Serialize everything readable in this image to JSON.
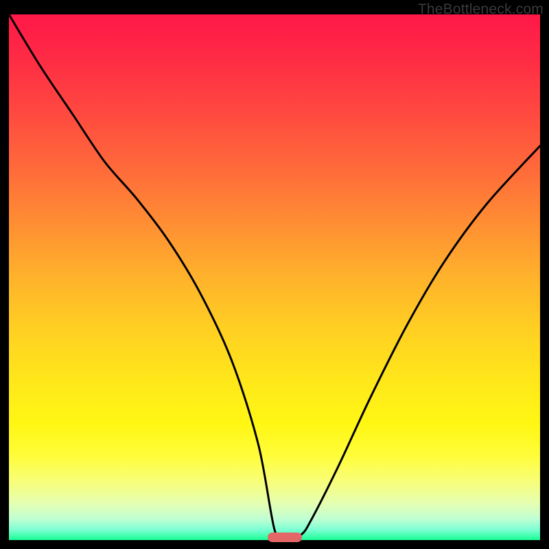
{
  "watermark": "TheBottleneck.com",
  "chart_data": {
    "type": "line",
    "title": "",
    "xlabel": "",
    "ylabel": "",
    "xlim": [
      0,
      100
    ],
    "ylim": [
      0,
      100
    ],
    "grid": false,
    "series": [
      {
        "name": "bottleneck-curve",
        "x": [
          0,
          6,
          12,
          18,
          24,
          30,
          36,
          42,
          47,
          50,
          52,
          55,
          57,
          62,
          68,
          75,
          82,
          90,
          100
        ],
        "values": [
          100,
          90,
          81,
          72,
          65,
          57,
          47,
          34,
          18,
          2,
          0,
          1,
          4,
          14,
          27,
          41,
          53,
          64,
          75
        ]
      }
    ],
    "marker": {
      "x": 52,
      "y": 0,
      "color": "#e46767"
    },
    "gradient_stops": [
      {
        "pos": 0,
        "color": "#ff1848"
      },
      {
        "pos": 50,
        "color": "#ffb22b"
      },
      {
        "pos": 78,
        "color": "#fff714"
      },
      {
        "pos": 100,
        "color": "#18ff94"
      }
    ]
  }
}
